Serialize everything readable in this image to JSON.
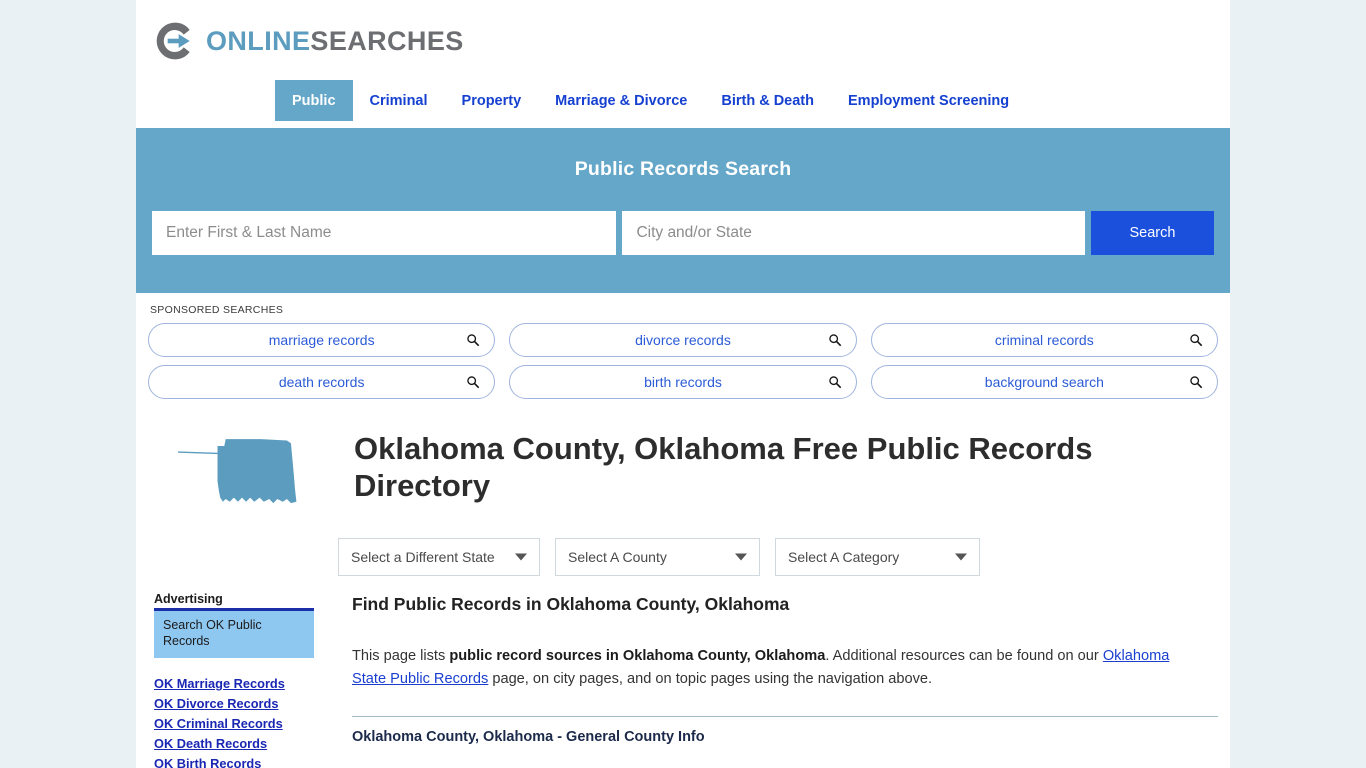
{
  "brand": {
    "logo_icon": "circle-arrow-icon",
    "name_part1": "ONLINE",
    "name_part2": "SEARCHES"
  },
  "nav": {
    "tabs": [
      {
        "label": "Public",
        "active": true
      },
      {
        "label": "Criminal",
        "active": false
      },
      {
        "label": "Property",
        "active": false
      },
      {
        "label": "Marriage & Divorce",
        "active": false
      },
      {
        "label": "Birth & Death",
        "active": false
      },
      {
        "label": "Employment Screening",
        "active": false
      }
    ]
  },
  "search": {
    "title": "Public Records Search",
    "name_placeholder": "Enter First & Last Name",
    "name_value": "",
    "location_placeholder": "City and/or State",
    "location_value": "",
    "button_label": "Search",
    "banner_color": "#64a7c8",
    "button_color": "#1b50dd"
  },
  "sponsored": {
    "label": "SPONSORED SEARCHES",
    "row1": [
      {
        "label": "marriage records",
        "icon": "search-icon"
      },
      {
        "label": "divorce records",
        "icon": "search-icon"
      },
      {
        "label": "criminal records",
        "icon": "search-icon"
      }
    ],
    "row2": [
      {
        "label": "death records",
        "icon": "search-icon"
      },
      {
        "label": "birth records",
        "icon": "search-icon"
      },
      {
        "label": "background search",
        "icon": "search-icon"
      }
    ]
  },
  "hero": {
    "map_icon": "oklahoma-state-map-icon",
    "title": "Oklahoma County, Oklahoma Free Public Records Directory"
  },
  "selects": {
    "state": "Select a Different State",
    "county": "Select A County",
    "category": "Select A Category"
  },
  "sidebar": {
    "advertising_label": "Advertising",
    "ad_text": "Search OK Public Records",
    "links": [
      "OK Marriage Records",
      "OK Divorce Records",
      "OK Criminal Records",
      "OK Death Records",
      "OK Birth Records"
    ]
  },
  "main": {
    "section_heading": "Find Public Records in Oklahoma County, Oklahoma",
    "intro_lead": "This page lists ",
    "intro_bold": "public record sources in Oklahoma County, Oklahoma",
    "intro_mid": ". Additional resources can be found on our ",
    "intro_link": "Oklahoma State Public Records",
    "intro_tail": " page, on city pages, and on topic pages using the navigation above.",
    "table_first_row": "Oklahoma County, Oklahoma - General County Info"
  }
}
